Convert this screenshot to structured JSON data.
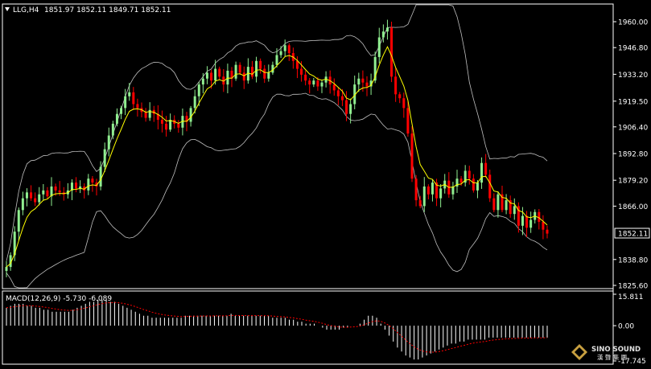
{
  "header": {
    "symbol_tf": "LLG,H4",
    "ohlc": "1851.97 1852.11 1849.71 1852.11"
  },
  "macd": {
    "label": "MACD(12,26,9) -5.730 -6.089",
    "axis_labels": [
      "15.811",
      "0.00",
      "-17.745"
    ],
    "ylim": [
      -17.745,
      15.811
    ]
  },
  "logo": {
    "name": "SINO SOUND",
    "subtitle": "漢 聲 集 團"
  },
  "colors": {
    "background": "#000000",
    "bull": "#90ee90",
    "bear": "#ff0000",
    "ma": "#ffff00",
    "bands": "#c0c0c0",
    "signal": "#ff0000",
    "histogram": "#ffffff",
    "current_price_box": "#000000"
  },
  "chart_data": {
    "type": "candlestick",
    "price_axis_ticks": [
      1960.0,
      1946.8,
      1933.2,
      1919.5,
      1906.4,
      1892.8,
      1879.2,
      1866.0,
      1838.8,
      1825.6
    ],
    "current_price": "1852.11",
    "ylim": [
      1825.6,
      1964
    ],
    "grid": false,
    "closes": [
      1835,
      1841,
      1853,
      1864,
      1870,
      1873,
      1870,
      1868,
      1872,
      1874,
      1871,
      1876,
      1874,
      1873,
      1872,
      1874,
      1878,
      1875,
      1876,
      1874,
      1880,
      1878,
      1876,
      1886,
      1895,
      1902,
      1908,
      1913,
      1916,
      1922,
      1924,
      1918,
      1916,
      1914,
      1911,
      1915,
      1913,
      1910,
      1908,
      1905,
      1910,
      1908,
      1906,
      1912,
      1909,
      1916,
      1922,
      1928,
      1931,
      1934,
      1930,
      1936,
      1932,
      1928,
      1935,
      1931,
      1938,
      1934,
      1930,
      1937,
      1932,
      1940,
      1936,
      1931,
      1934,
      1938,
      1943,
      1945,
      1948,
      1944,
      1940,
      1936,
      1933,
      1930,
      1928,
      1930,
      1927,
      1929,
      1932,
      1928,
      1925,
      1922,
      1920,
      1913,
      1918,
      1928,
      1931,
      1929,
      1927,
      1930,
      1942,
      1952,
      1955,
      1957,
      1932,
      1923,
      1921,
      1916,
      1903,
      1880,
      1869,
      1866,
      1876,
      1872,
      1878,
      1870,
      1875,
      1879,
      1872,
      1876,
      1880,
      1878,
      1884,
      1880,
      1874,
      1878,
      1888,
      1882,
      1870,
      1864,
      1872,
      1864,
      1869,
      1862,
      1866,
      1856,
      1861,
      1855,
      1859,
      1863,
      1858,
      1854,
      1852
    ],
    "macd_histogram": [
      9,
      10,
      11,
      11,
      11,
      10,
      10,
      9,
      9,
      8,
      8,
      7,
      7,
      7,
      7,
      7,
      8,
      9,
      10,
      11,
      12,
      12,
      13,
      13,
      13,
      12,
      12,
      11,
      10,
      9,
      8,
      7,
      6,
      5,
      5,
      4,
      4,
      4,
      4,
      4,
      4,
      4,
      4,
      5,
      5,
      5,
      5,
      5,
      5,
      5,
      5,
      5,
      5,
      5,
      6,
      5,
      5,
      5,
      5,
      5,
      5,
      5,
      5,
      5,
      4,
      4,
      4,
      4,
      3,
      3,
      2,
      2,
      1,
      1,
      1,
      0,
      -1,
      -2,
      -2,
      -2,
      -2,
      -1,
      -1,
      0,
      0,
      1,
      3,
      5,
      5,
      4,
      1,
      -2,
      -5,
      -8,
      -11,
      -13,
      -15,
      -16,
      -17,
      -17,
      -16,
      -15,
      -14,
      -13,
      -12,
      -11,
      -10,
      -9,
      -9,
      -8,
      -8,
      -7,
      -7,
      -7,
      -7,
      -7,
      -6,
      -6,
      -6,
      -6,
      -6,
      -6,
      -6,
      -6,
      -6,
      -6,
      -6,
      -6,
      -6,
      -6,
      -6
    ]
  }
}
